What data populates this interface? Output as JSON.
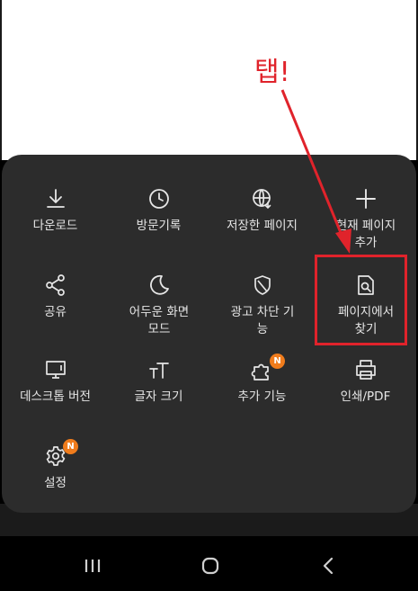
{
  "annotation": {
    "text": "탭!"
  },
  "menu": {
    "items": [
      {
        "label": "다운로드",
        "icon": "download-icon"
      },
      {
        "label": "방문기록",
        "icon": "clock-icon"
      },
      {
        "label": "저장한 페이지",
        "icon": "saved-pages-globe-icon"
      },
      {
        "label": "현재 페이지 추가",
        "icon": "plus-icon"
      },
      {
        "label": "공유",
        "icon": "share-icon"
      },
      {
        "label": "어두운 화면 모드",
        "icon": "moon-icon"
      },
      {
        "label": "광고 차단 기능",
        "icon": "shield-icon"
      },
      {
        "label": "페이지에서 찾기",
        "icon": "find-in-page-icon"
      },
      {
        "label": "데스크톱 버전",
        "icon": "desktop-icon"
      },
      {
        "label": "글자 크기",
        "icon": "text-size-icon"
      },
      {
        "label": "추가 기능",
        "icon": "puzzle-icon",
        "badge": "N"
      },
      {
        "label": "인쇄/PDF",
        "icon": "printer-icon"
      },
      {
        "label": "설정",
        "icon": "gear-icon",
        "badge": "N"
      }
    ]
  },
  "navbar": {
    "icons": [
      "recents-icon",
      "home-icon",
      "back-icon"
    ]
  },
  "colors": {
    "sheet": "#2c2c2c",
    "annotation": "#e0232b",
    "badge": "#f07c1c"
  }
}
